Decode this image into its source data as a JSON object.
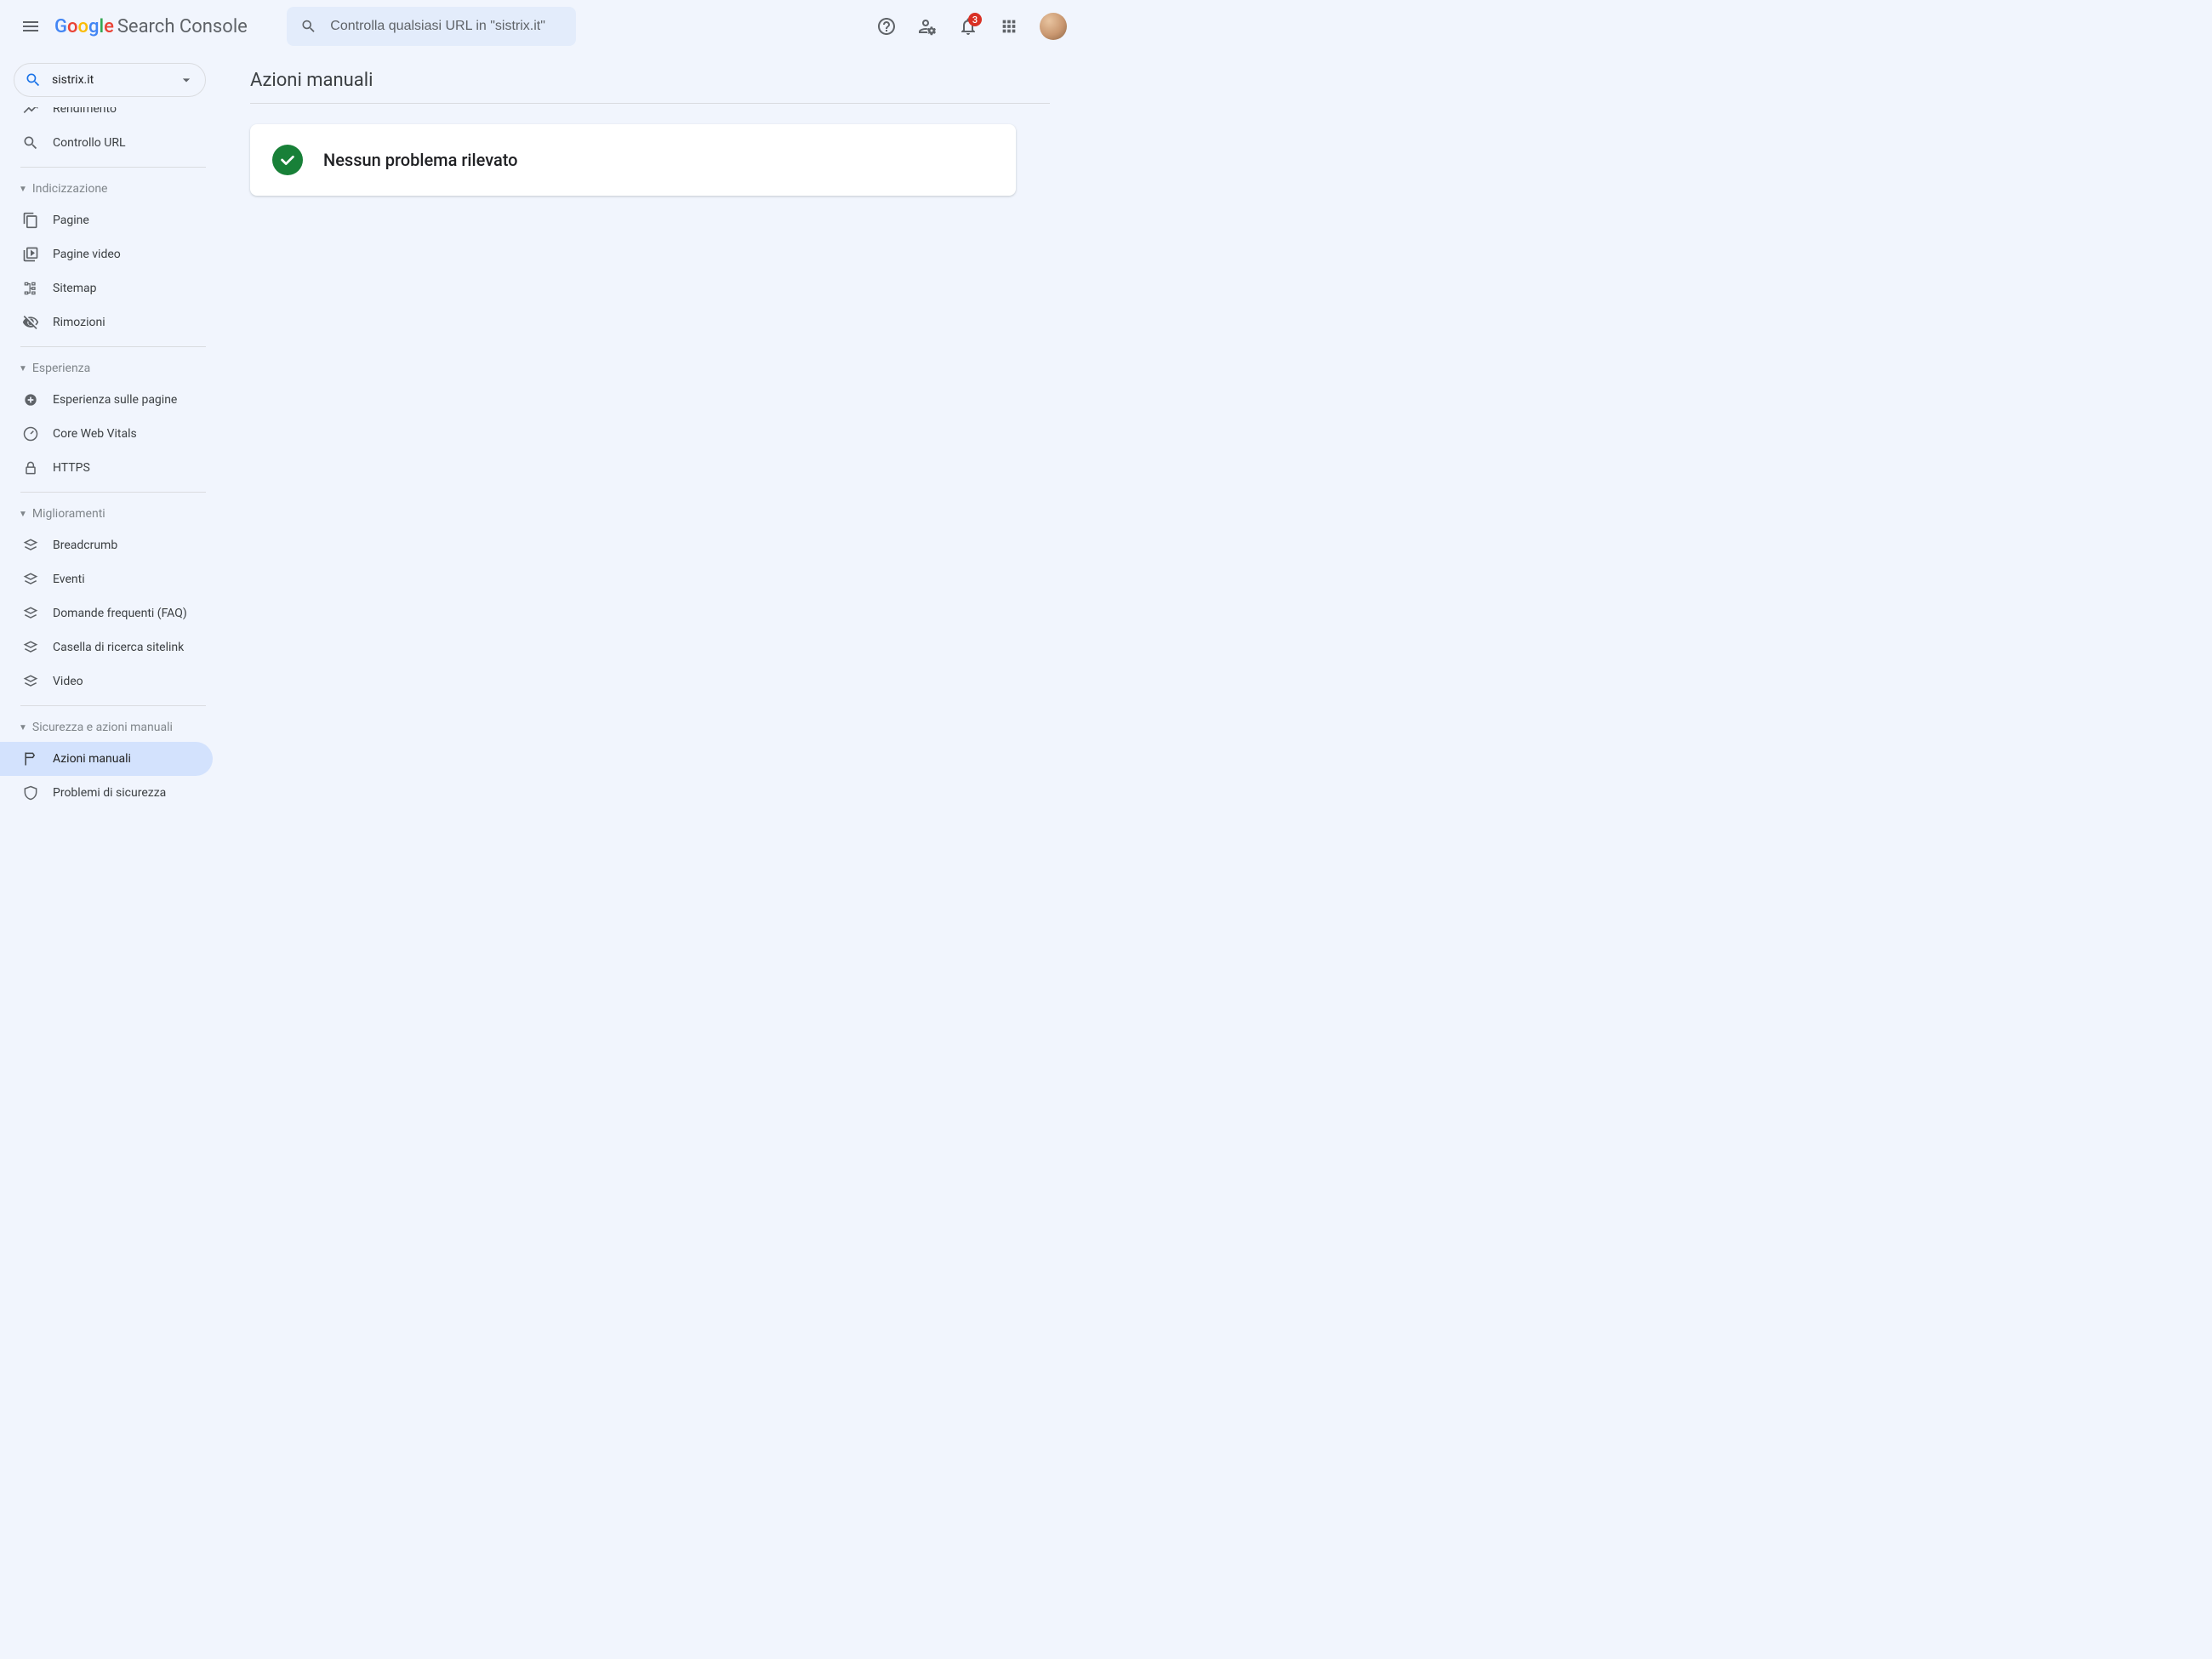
{
  "app": {
    "logo_text": "Search Console"
  },
  "search": {
    "placeholder": "Controlla qualsiasi URL in \"sistrix.it\""
  },
  "header": {
    "notifications_count": "3"
  },
  "property": {
    "name": "sistrix.it"
  },
  "sidebar": {
    "item_rendimento": "Rendimento",
    "item_controllo_url": "Controllo URL",
    "section_indicizzazione": "Indicizzazione",
    "item_pagine": "Pagine",
    "item_pagine_video": "Pagine video",
    "item_sitemap": "Sitemap",
    "item_rimozioni": "Rimozioni",
    "section_esperienza": "Esperienza",
    "item_esperienza_pagine": "Esperienza sulle pagine",
    "item_core_web_vitals": "Core Web Vitals",
    "item_https": "HTTPS",
    "section_miglioramenti": "Miglioramenti",
    "item_breadcrumb": "Breadcrumb",
    "item_eventi": "Eventi",
    "item_faq": "Domande frequenti (FAQ)",
    "item_sitelink": "Casella di ricerca sitelink",
    "item_video": "Video",
    "section_sicurezza": "Sicurezza e azioni manuali",
    "item_azioni_manuali": "Azioni manuali",
    "item_problemi_sicurezza": "Problemi di sicurezza"
  },
  "main": {
    "title": "Azioni manuali",
    "status_message": "Nessun problema rilevato"
  }
}
